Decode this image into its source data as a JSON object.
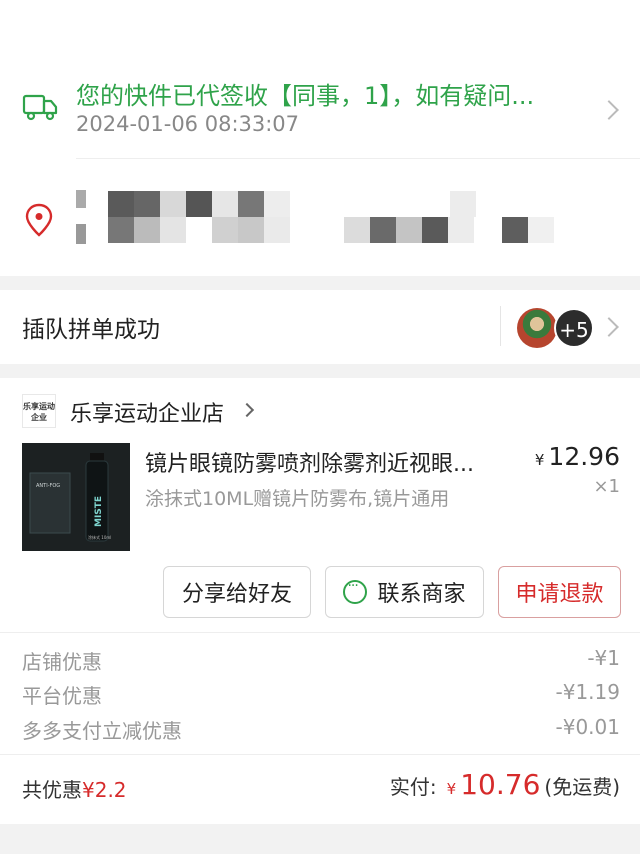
{
  "logistics": {
    "status_text": "您的快件已代签收【同事，1】，如有疑问...",
    "time": "2024-01-06 08:33:07",
    "truck_icon": "truck-icon",
    "pin_icon": "location-pin-icon"
  },
  "group": {
    "label": "插队拼单成功",
    "extra_count": "+5"
  },
  "shop": {
    "logo_text": "乐享运动企业",
    "name": "乐享运动企业店"
  },
  "product": {
    "name": "镜片眼镜防雾喷剂除雾剂近视眼...",
    "spec": "涂抹式10ML赠镜片防雾布,镜片通用",
    "currency": "¥",
    "price": "12.96",
    "qty": "×1",
    "image_label": "MISTE",
    "image_small": "涂抹式 10ml",
    "image_box": "ANTI-FOG"
  },
  "actions": {
    "share": "分享给好友",
    "contact": "联系商家",
    "refund": "申请退款"
  },
  "discounts": [
    {
      "label": "店铺优惠",
      "value": "-¥1"
    },
    {
      "label": "平台优惠",
      "value": "-¥1.19"
    },
    {
      "label": "多多支付立减优惠",
      "value": "-¥0.01"
    }
  ],
  "total": {
    "saved_label": "共优惠",
    "saved_value": "¥2.2",
    "paid_label": "实付:",
    "currency": "¥",
    "paid_value": "10.76",
    "shipping": "(免运费)"
  },
  "colors": {
    "green": "#2fa34a",
    "red": "#d62b2b"
  }
}
